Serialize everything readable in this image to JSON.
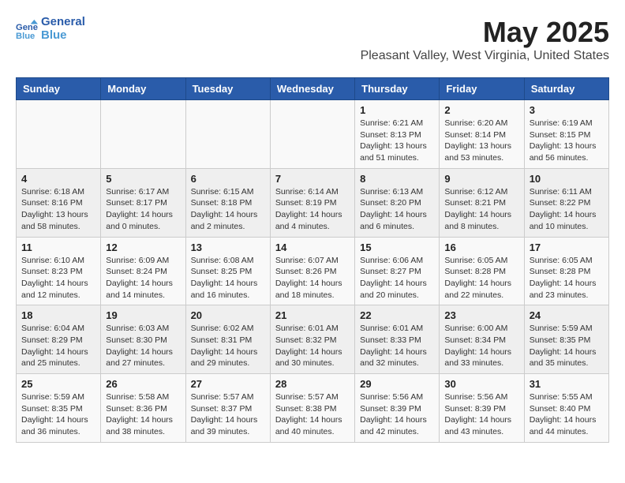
{
  "header": {
    "logo_line1": "General",
    "logo_line2": "Blue",
    "month": "May 2025",
    "location": "Pleasant Valley, West Virginia, United States"
  },
  "weekdays": [
    "Sunday",
    "Monday",
    "Tuesday",
    "Wednesday",
    "Thursday",
    "Friday",
    "Saturday"
  ],
  "weeks": [
    [
      {
        "day": "",
        "sunrise": "",
        "sunset": "",
        "daylight": ""
      },
      {
        "day": "",
        "sunrise": "",
        "sunset": "",
        "daylight": ""
      },
      {
        "day": "",
        "sunrise": "",
        "sunset": "",
        "daylight": ""
      },
      {
        "day": "",
        "sunrise": "",
        "sunset": "",
        "daylight": ""
      },
      {
        "day": "1",
        "sunrise": "Sunrise: 6:21 AM",
        "sunset": "Sunset: 8:13 PM",
        "daylight": "Daylight: 13 hours and 51 minutes."
      },
      {
        "day": "2",
        "sunrise": "Sunrise: 6:20 AM",
        "sunset": "Sunset: 8:14 PM",
        "daylight": "Daylight: 13 hours and 53 minutes."
      },
      {
        "day": "3",
        "sunrise": "Sunrise: 6:19 AM",
        "sunset": "Sunset: 8:15 PM",
        "daylight": "Daylight: 13 hours and 56 minutes."
      }
    ],
    [
      {
        "day": "4",
        "sunrise": "Sunrise: 6:18 AM",
        "sunset": "Sunset: 8:16 PM",
        "daylight": "Daylight: 13 hours and 58 minutes."
      },
      {
        "day": "5",
        "sunrise": "Sunrise: 6:17 AM",
        "sunset": "Sunset: 8:17 PM",
        "daylight": "Daylight: 14 hours and 0 minutes."
      },
      {
        "day": "6",
        "sunrise": "Sunrise: 6:15 AM",
        "sunset": "Sunset: 8:18 PM",
        "daylight": "Daylight: 14 hours and 2 minutes."
      },
      {
        "day": "7",
        "sunrise": "Sunrise: 6:14 AM",
        "sunset": "Sunset: 8:19 PM",
        "daylight": "Daylight: 14 hours and 4 minutes."
      },
      {
        "day": "8",
        "sunrise": "Sunrise: 6:13 AM",
        "sunset": "Sunset: 8:20 PM",
        "daylight": "Daylight: 14 hours and 6 minutes."
      },
      {
        "day": "9",
        "sunrise": "Sunrise: 6:12 AM",
        "sunset": "Sunset: 8:21 PM",
        "daylight": "Daylight: 14 hours and 8 minutes."
      },
      {
        "day": "10",
        "sunrise": "Sunrise: 6:11 AM",
        "sunset": "Sunset: 8:22 PM",
        "daylight": "Daylight: 14 hours and 10 minutes."
      }
    ],
    [
      {
        "day": "11",
        "sunrise": "Sunrise: 6:10 AM",
        "sunset": "Sunset: 8:23 PM",
        "daylight": "Daylight: 14 hours and 12 minutes."
      },
      {
        "day": "12",
        "sunrise": "Sunrise: 6:09 AM",
        "sunset": "Sunset: 8:24 PM",
        "daylight": "Daylight: 14 hours and 14 minutes."
      },
      {
        "day": "13",
        "sunrise": "Sunrise: 6:08 AM",
        "sunset": "Sunset: 8:25 PM",
        "daylight": "Daylight: 14 hours and 16 minutes."
      },
      {
        "day": "14",
        "sunrise": "Sunrise: 6:07 AM",
        "sunset": "Sunset: 8:26 PM",
        "daylight": "Daylight: 14 hours and 18 minutes."
      },
      {
        "day": "15",
        "sunrise": "Sunrise: 6:06 AM",
        "sunset": "Sunset: 8:27 PM",
        "daylight": "Daylight: 14 hours and 20 minutes."
      },
      {
        "day": "16",
        "sunrise": "Sunrise: 6:05 AM",
        "sunset": "Sunset: 8:28 PM",
        "daylight": "Daylight: 14 hours and 22 minutes."
      },
      {
        "day": "17",
        "sunrise": "Sunrise: 6:05 AM",
        "sunset": "Sunset: 8:28 PM",
        "daylight": "Daylight: 14 hours and 23 minutes."
      }
    ],
    [
      {
        "day": "18",
        "sunrise": "Sunrise: 6:04 AM",
        "sunset": "Sunset: 8:29 PM",
        "daylight": "Daylight: 14 hours and 25 minutes."
      },
      {
        "day": "19",
        "sunrise": "Sunrise: 6:03 AM",
        "sunset": "Sunset: 8:30 PM",
        "daylight": "Daylight: 14 hours and 27 minutes."
      },
      {
        "day": "20",
        "sunrise": "Sunrise: 6:02 AM",
        "sunset": "Sunset: 8:31 PM",
        "daylight": "Daylight: 14 hours and 29 minutes."
      },
      {
        "day": "21",
        "sunrise": "Sunrise: 6:01 AM",
        "sunset": "Sunset: 8:32 PM",
        "daylight": "Daylight: 14 hours and 30 minutes."
      },
      {
        "day": "22",
        "sunrise": "Sunrise: 6:01 AM",
        "sunset": "Sunset: 8:33 PM",
        "daylight": "Daylight: 14 hours and 32 minutes."
      },
      {
        "day": "23",
        "sunrise": "Sunrise: 6:00 AM",
        "sunset": "Sunset: 8:34 PM",
        "daylight": "Daylight: 14 hours and 33 minutes."
      },
      {
        "day": "24",
        "sunrise": "Sunrise: 5:59 AM",
        "sunset": "Sunset: 8:35 PM",
        "daylight": "Daylight: 14 hours and 35 minutes."
      }
    ],
    [
      {
        "day": "25",
        "sunrise": "Sunrise: 5:59 AM",
        "sunset": "Sunset: 8:35 PM",
        "daylight": "Daylight: 14 hours and 36 minutes."
      },
      {
        "day": "26",
        "sunrise": "Sunrise: 5:58 AM",
        "sunset": "Sunset: 8:36 PM",
        "daylight": "Daylight: 14 hours and 38 minutes."
      },
      {
        "day": "27",
        "sunrise": "Sunrise: 5:57 AM",
        "sunset": "Sunset: 8:37 PM",
        "daylight": "Daylight: 14 hours and 39 minutes."
      },
      {
        "day": "28",
        "sunrise": "Sunrise: 5:57 AM",
        "sunset": "Sunset: 8:38 PM",
        "daylight": "Daylight: 14 hours and 40 minutes."
      },
      {
        "day": "29",
        "sunrise": "Sunrise: 5:56 AM",
        "sunset": "Sunset: 8:39 PM",
        "daylight": "Daylight: 14 hours and 42 minutes."
      },
      {
        "day": "30",
        "sunrise": "Sunrise: 5:56 AM",
        "sunset": "Sunset: 8:39 PM",
        "daylight": "Daylight: 14 hours and 43 minutes."
      },
      {
        "day": "31",
        "sunrise": "Sunrise: 5:55 AM",
        "sunset": "Sunset: 8:40 PM",
        "daylight": "Daylight: 14 hours and 44 minutes."
      }
    ]
  ]
}
